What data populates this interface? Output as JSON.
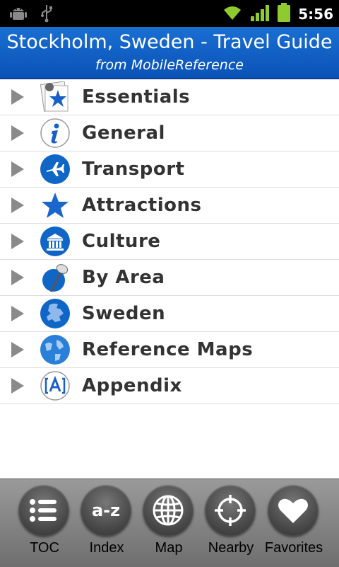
{
  "status_bar": {
    "time": "5:56",
    "icons": [
      "android-debug-icon",
      "usb-icon",
      "wifi-icon",
      "signal-icon",
      "battery-icon"
    ]
  },
  "header": {
    "title": "Stockholm, Sweden - Travel Guide",
    "subtitle": "from MobileReference",
    "color": "#0a5ac4"
  },
  "menu": {
    "items": [
      {
        "label": "Essentials",
        "icon": "essentials-star-icon"
      },
      {
        "label": "General",
        "icon": "info-icon"
      },
      {
        "label": "Transport",
        "icon": "airplane-icon"
      },
      {
        "label": "Attractions",
        "icon": "star-icon"
      },
      {
        "label": "Culture",
        "icon": "museum-icon"
      },
      {
        "label": "By Area",
        "icon": "pushpin-icon"
      },
      {
        "label": "Sweden",
        "icon": "europe-globe-icon"
      },
      {
        "label": "Reference Maps",
        "icon": "globe-icon"
      },
      {
        "label": "Appendix",
        "icon": "appendix-icon"
      }
    ]
  },
  "toolbar": {
    "buttons": [
      {
        "label": "TOC",
        "icon": "list-icon"
      },
      {
        "label": "Index",
        "icon": "a-z-icon"
      },
      {
        "label": "Map",
        "icon": "globe-grid-icon"
      },
      {
        "label": "Nearby",
        "icon": "crosshair-icon"
      },
      {
        "label": "Favorites",
        "icon": "heart-icon"
      }
    ],
    "a_z_text": "a-z"
  }
}
